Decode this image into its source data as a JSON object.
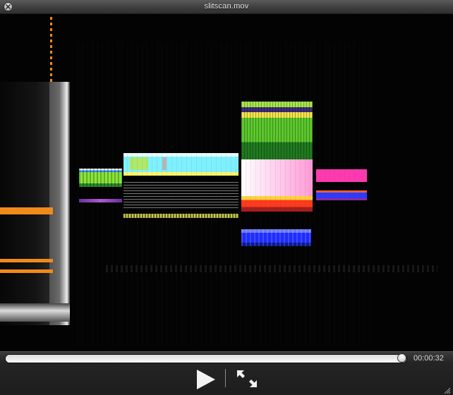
{
  "window": {
    "title": "slitscan.mov"
  },
  "player": {
    "time_display": "00:00:32",
    "progress": 0.99
  },
  "icons": {
    "close": "close-icon",
    "play": "play-icon",
    "fullscreen": "fullscreen-icon",
    "resize": "resize-grip-icon"
  },
  "colors": {
    "titlebar": "#444444",
    "controls_bg": "#222222",
    "scrubber_track": "#e8e8e8",
    "orange_stripe": "#f08a1c",
    "magenta_block": "#ff3ab0",
    "cyan_block": "#7ff0ff",
    "blue_block": "#1e2cff"
  }
}
